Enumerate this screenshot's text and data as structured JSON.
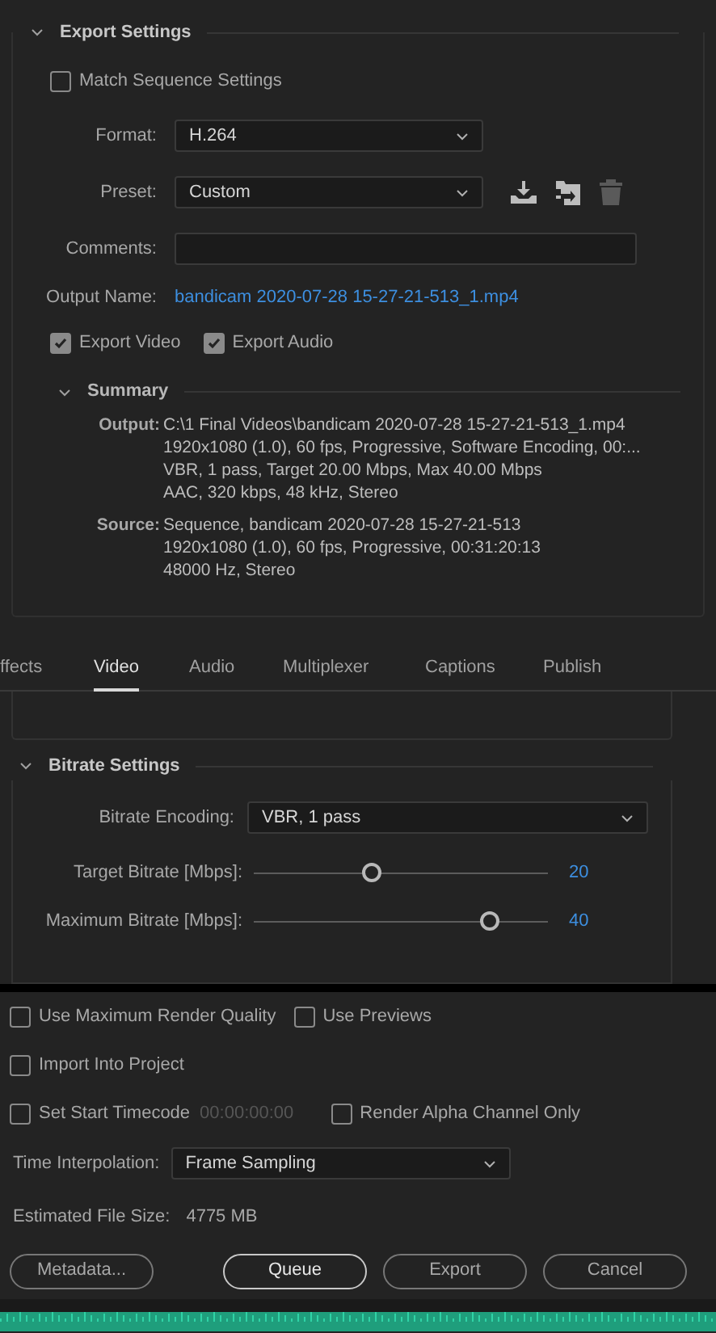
{
  "export_settings": {
    "title": "Export Settings",
    "expanded": true,
    "match_sequence": {
      "label": "Match Sequence Settings",
      "checked": false
    },
    "format": {
      "label": "Format:",
      "value": "H.264"
    },
    "preset": {
      "label": "Preset:",
      "value": "Custom"
    },
    "comments": {
      "label": "Comments:"
    },
    "output_name": {
      "label": "Output Name:",
      "value": "bandicam 2020-07-28 15-27-21-513_1.mp4"
    },
    "export_video": {
      "label": "Export Video",
      "checked": true
    },
    "export_audio": {
      "label": "Export Audio",
      "checked": true
    },
    "summary": {
      "title": "Summary",
      "expanded": true,
      "groups": [
        {
          "label": "Output:",
          "lines": [
            "C:\\1 Final Videos\\bandicam 2020-07-28 15-27-21-513_1.mp4",
            "1920x1080 (1.0), 60 fps, Progressive, Software Encoding, 00:...",
            "VBR, 1 pass, Target 20.00 Mbps, Max 40.00 Mbps",
            "AAC, 320 kbps, 48 kHz, Stereo"
          ]
        },
        {
          "label": "Source:",
          "lines": [
            "Sequence, bandicam 2020-07-28 15-27-21-513",
            "1920x1080 (1.0), 60 fps, Progressive, 00:31:20:13",
            "48000 Hz, Stereo"
          ]
        }
      ]
    }
  },
  "tabs": [
    {
      "label": "ffects",
      "selected": false
    },
    {
      "label": "Video",
      "selected": true
    },
    {
      "label": "Audio",
      "selected": false
    },
    {
      "label": "Multiplexer",
      "selected": false
    },
    {
      "label": "Captions",
      "selected": false
    },
    {
      "label": "Publish",
      "selected": false
    }
  ],
  "bitrate_settings": {
    "title": "Bitrate Settings",
    "expanded": true,
    "encoding": {
      "label": "Bitrate Encoding:",
      "value": "VBR, 1 pass"
    },
    "sliders": [
      {
        "label": "Target Bitrate [Mbps]:",
        "level": 0.4,
        "reading": "20"
      },
      {
        "label": "Maximum Bitrate [Mbps]:",
        "level": 0.8,
        "reading": "40"
      }
    ]
  },
  "option_rows": [
    [
      {
        "label": "Use Maximum Render Quality",
        "checked": false
      },
      {
        "label": "Use Previews",
        "checked": false
      }
    ],
    [
      {
        "label": "Import Into Project",
        "checked": false
      }
    ],
    [
      {
        "label": "Set Start Timecode",
        "checked": false,
        "timecode": "00:00:00:00"
      },
      {
        "label": "Render Alpha Channel Only",
        "checked": false
      }
    ]
  ],
  "time_interpolation": {
    "label": "Time Interpolation:",
    "value": "Frame Sampling"
  },
  "estimated_file_size": {
    "label": "Estimated File Size:",
    "value": "4775 MB"
  },
  "buttons": [
    {
      "label": "Metadata...",
      "default": false
    },
    {
      "label": "Queue",
      "default": true
    },
    {
      "label": "Export",
      "default": false
    },
    {
      "label": "Cancel",
      "default": false
    }
  ]
}
